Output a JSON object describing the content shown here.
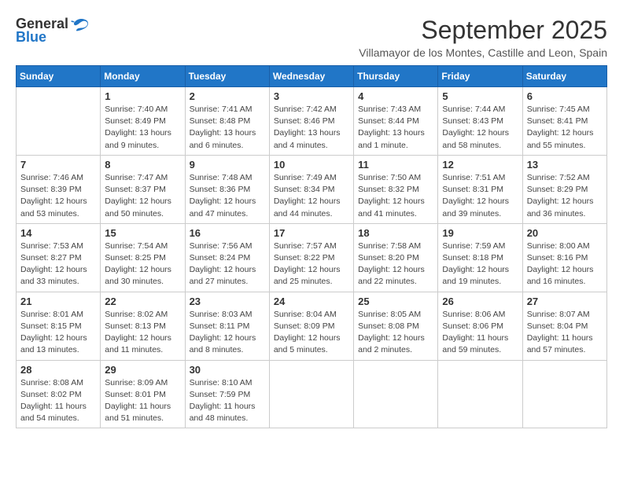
{
  "header": {
    "logo_general": "General",
    "logo_blue": "Blue",
    "month_title": "September 2025",
    "subtitle": "Villamayor de los Montes, Castille and Leon, Spain"
  },
  "weekdays": [
    "Sunday",
    "Monday",
    "Tuesday",
    "Wednesday",
    "Thursday",
    "Friday",
    "Saturday"
  ],
  "weeks": [
    [
      {
        "day": "",
        "info": ""
      },
      {
        "day": "1",
        "info": "Sunrise: 7:40 AM\nSunset: 8:49 PM\nDaylight: 13 hours\nand 9 minutes."
      },
      {
        "day": "2",
        "info": "Sunrise: 7:41 AM\nSunset: 8:48 PM\nDaylight: 13 hours\nand 6 minutes."
      },
      {
        "day": "3",
        "info": "Sunrise: 7:42 AM\nSunset: 8:46 PM\nDaylight: 13 hours\nand 4 minutes."
      },
      {
        "day": "4",
        "info": "Sunrise: 7:43 AM\nSunset: 8:44 PM\nDaylight: 13 hours\nand 1 minute."
      },
      {
        "day": "5",
        "info": "Sunrise: 7:44 AM\nSunset: 8:43 PM\nDaylight: 12 hours\nand 58 minutes."
      },
      {
        "day": "6",
        "info": "Sunrise: 7:45 AM\nSunset: 8:41 PM\nDaylight: 12 hours\nand 55 minutes."
      }
    ],
    [
      {
        "day": "7",
        "info": "Sunrise: 7:46 AM\nSunset: 8:39 PM\nDaylight: 12 hours\nand 53 minutes."
      },
      {
        "day": "8",
        "info": "Sunrise: 7:47 AM\nSunset: 8:37 PM\nDaylight: 12 hours\nand 50 minutes."
      },
      {
        "day": "9",
        "info": "Sunrise: 7:48 AM\nSunset: 8:36 PM\nDaylight: 12 hours\nand 47 minutes."
      },
      {
        "day": "10",
        "info": "Sunrise: 7:49 AM\nSunset: 8:34 PM\nDaylight: 12 hours\nand 44 minutes."
      },
      {
        "day": "11",
        "info": "Sunrise: 7:50 AM\nSunset: 8:32 PM\nDaylight: 12 hours\nand 41 minutes."
      },
      {
        "day": "12",
        "info": "Sunrise: 7:51 AM\nSunset: 8:31 PM\nDaylight: 12 hours\nand 39 minutes."
      },
      {
        "day": "13",
        "info": "Sunrise: 7:52 AM\nSunset: 8:29 PM\nDaylight: 12 hours\nand 36 minutes."
      }
    ],
    [
      {
        "day": "14",
        "info": "Sunrise: 7:53 AM\nSunset: 8:27 PM\nDaylight: 12 hours\nand 33 minutes."
      },
      {
        "day": "15",
        "info": "Sunrise: 7:54 AM\nSunset: 8:25 PM\nDaylight: 12 hours\nand 30 minutes."
      },
      {
        "day": "16",
        "info": "Sunrise: 7:56 AM\nSunset: 8:24 PM\nDaylight: 12 hours\nand 27 minutes."
      },
      {
        "day": "17",
        "info": "Sunrise: 7:57 AM\nSunset: 8:22 PM\nDaylight: 12 hours\nand 25 minutes."
      },
      {
        "day": "18",
        "info": "Sunrise: 7:58 AM\nSunset: 8:20 PM\nDaylight: 12 hours\nand 22 minutes."
      },
      {
        "day": "19",
        "info": "Sunrise: 7:59 AM\nSunset: 8:18 PM\nDaylight: 12 hours\nand 19 minutes."
      },
      {
        "day": "20",
        "info": "Sunrise: 8:00 AM\nSunset: 8:16 PM\nDaylight: 12 hours\nand 16 minutes."
      }
    ],
    [
      {
        "day": "21",
        "info": "Sunrise: 8:01 AM\nSunset: 8:15 PM\nDaylight: 12 hours\nand 13 minutes."
      },
      {
        "day": "22",
        "info": "Sunrise: 8:02 AM\nSunset: 8:13 PM\nDaylight: 12 hours\nand 11 minutes."
      },
      {
        "day": "23",
        "info": "Sunrise: 8:03 AM\nSunset: 8:11 PM\nDaylight: 12 hours\nand 8 minutes."
      },
      {
        "day": "24",
        "info": "Sunrise: 8:04 AM\nSunset: 8:09 PM\nDaylight: 12 hours\nand 5 minutes."
      },
      {
        "day": "25",
        "info": "Sunrise: 8:05 AM\nSunset: 8:08 PM\nDaylight: 12 hours\nand 2 minutes."
      },
      {
        "day": "26",
        "info": "Sunrise: 8:06 AM\nSunset: 8:06 PM\nDaylight: 11 hours\nand 59 minutes."
      },
      {
        "day": "27",
        "info": "Sunrise: 8:07 AM\nSunset: 8:04 PM\nDaylight: 11 hours\nand 57 minutes."
      }
    ],
    [
      {
        "day": "28",
        "info": "Sunrise: 8:08 AM\nSunset: 8:02 PM\nDaylight: 11 hours\nand 54 minutes."
      },
      {
        "day": "29",
        "info": "Sunrise: 8:09 AM\nSunset: 8:01 PM\nDaylight: 11 hours\nand 51 minutes."
      },
      {
        "day": "30",
        "info": "Sunrise: 8:10 AM\nSunset: 7:59 PM\nDaylight: 11 hours\nand 48 minutes."
      },
      {
        "day": "",
        "info": ""
      },
      {
        "day": "",
        "info": ""
      },
      {
        "day": "",
        "info": ""
      },
      {
        "day": "",
        "info": ""
      }
    ]
  ]
}
